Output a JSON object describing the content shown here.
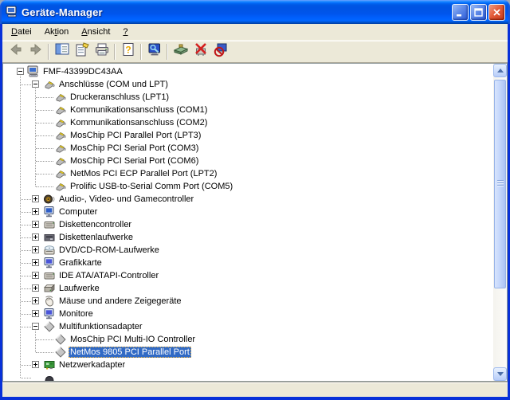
{
  "window": {
    "title": "Geräte-Manager",
    "controls": [
      {
        "name": "minimize",
        "icon": "minimize-icon"
      },
      {
        "name": "maximize",
        "icon": "maximize-icon"
      },
      {
        "name": "close",
        "icon": "close-icon"
      }
    ]
  },
  "menu": {
    "items": [
      {
        "label": "Datei",
        "underline": 0
      },
      {
        "label": "Aktion",
        "underline": 2
      },
      {
        "label": "Ansicht",
        "underline": 0
      },
      {
        "label": "?",
        "underline": 0
      }
    ]
  },
  "toolbar": {
    "buttons": [
      {
        "icon": "back-arrow",
        "disabled": true
      },
      {
        "icon": "forward-arrow",
        "disabled": true
      },
      {
        "sep": true
      },
      {
        "icon": "show-hide-console-tree"
      },
      {
        "icon": "properties"
      },
      {
        "icon": "print"
      },
      {
        "sep": true
      },
      {
        "icon": "help"
      },
      {
        "sep": true
      },
      {
        "icon": "scan-hardware-changes"
      },
      {
        "sep": true
      },
      {
        "icon": "update-driver"
      },
      {
        "icon": "disable-device"
      },
      {
        "icon": "uninstall-device"
      }
    ]
  },
  "tree": {
    "items": [
      {
        "label": "FMF-43399DC43AA",
        "level": 0,
        "expand": "minus",
        "icon": "computer-root"
      },
      {
        "label": "Anschlüsse (COM und LPT)",
        "level": 1,
        "expand": "minus",
        "icon": "port"
      },
      {
        "label": "Druckeranschluss (LPT1)",
        "level": 2,
        "icon": "port"
      },
      {
        "label": "Kommunikationsanschluss (COM1)",
        "level": 2,
        "icon": "port"
      },
      {
        "label": "Kommunikationsanschluss (COM2)",
        "level": 2,
        "icon": "port"
      },
      {
        "label": "MosChip PCI Parallel Port (LPT3)",
        "level": 2,
        "icon": "port"
      },
      {
        "label": "MosChip PCI Serial Port (COM3)",
        "level": 2,
        "icon": "port"
      },
      {
        "label": "MosChip PCI Serial Port (COM6)",
        "level": 2,
        "icon": "port"
      },
      {
        "label": "NetMos PCI ECP Parallel Port (LPT2)",
        "level": 2,
        "icon": "port"
      },
      {
        "label": "Prolific USB-to-Serial Comm Port (COM5)",
        "level": 2,
        "icon": "port"
      },
      {
        "label": "Audio-, Video- und Gamecontroller",
        "level": 1,
        "expand": "plus",
        "icon": "audio"
      },
      {
        "label": "Computer",
        "level": 1,
        "expand": "plus",
        "icon": "computer"
      },
      {
        "label": "Diskettencontroller",
        "level": 1,
        "expand": "plus",
        "icon": "controller"
      },
      {
        "label": "Diskettenlaufwerke",
        "level": 1,
        "expand": "plus",
        "icon": "floppy"
      },
      {
        "label": "DVD/CD-ROM-Laufwerke",
        "level": 1,
        "expand": "plus",
        "icon": "cdrom"
      },
      {
        "label": "Grafikkarte",
        "level": 1,
        "expand": "plus",
        "icon": "display"
      },
      {
        "label": "IDE ATA/ATAPI-Controller",
        "level": 1,
        "expand": "plus",
        "icon": "controller"
      },
      {
        "label": "Laufwerke",
        "level": 1,
        "expand": "plus",
        "icon": "disk"
      },
      {
        "label": "Mäuse und andere Zeigegeräte",
        "level": 1,
        "expand": "plus",
        "icon": "mouse"
      },
      {
        "label": "Monitore",
        "level": 1,
        "expand": "plus",
        "icon": "display"
      },
      {
        "label": "Multifunktionsadapter",
        "level": 1,
        "expand": "minus",
        "icon": "diamond"
      },
      {
        "label": "MosChip PCI Multi-IO Controller",
        "level": 2,
        "icon": "diamond"
      },
      {
        "label": "NetMos 9805 PCI Parallel Port",
        "level": 2,
        "icon": "diamond",
        "selected": true
      },
      {
        "label": "Netzwerkadapter",
        "level": 1,
        "expand": "plus",
        "icon": "network"
      },
      {
        "label": "",
        "level": 1,
        "icon": "dark-device",
        "partial": true
      }
    ]
  },
  "colors": {
    "selection": "#316AC5",
    "chrome": "#ECE9D8",
    "window_border": "#0831D9",
    "titlebar_blue": "#0054E3"
  }
}
